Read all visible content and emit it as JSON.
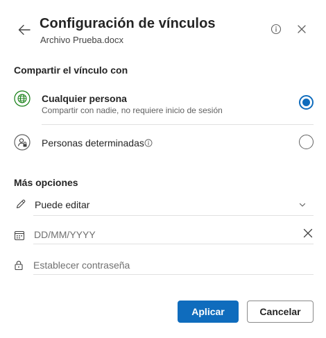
{
  "header": {
    "title": "Configuración de vínculos",
    "subtitle": "Archivo Prueba.docx"
  },
  "share_section": {
    "title": "Compartir el vínculo con",
    "options": [
      {
        "label": "Cualquier persona",
        "description": "Compartir con nadie, no requiere inicio de sesión",
        "selected": true,
        "icon": "globe-icon"
      },
      {
        "label": "Personas determinadas",
        "selected": false,
        "icon": "people-lock-icon"
      }
    ]
  },
  "more_options": {
    "title": "Más opciones",
    "permission": {
      "value": "Puede editar",
      "icon": "pencil-icon"
    },
    "expiration": {
      "placeholder": "DD/MM/YYYY",
      "icon": "calendar-icon"
    },
    "password": {
      "placeholder": "Establecer contraseña",
      "icon": "lock-icon"
    }
  },
  "footer": {
    "apply_label": "Aplicar",
    "cancel_label": "Cancelar"
  },
  "colors": {
    "accent": "#0f6cbd",
    "globe": "#107c10"
  }
}
